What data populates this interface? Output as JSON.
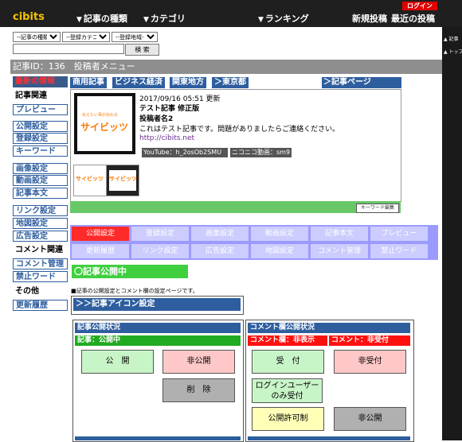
{
  "header": {
    "logo": "cibits",
    "login": "ログイン",
    "nav": {
      "article_type": "記事の種類",
      "category": "カテゴリ",
      "ranking": "ランキング",
      "new_post": "新規投稿",
      "recent_post": "最近の投稿"
    }
  },
  "right_strip": [
    "▲ 記事",
    "▲ トップ"
  ],
  "search": {
    "selects": [
      "--記事の種類--",
      "--登録カテゴリー--",
      "--登録地域--"
    ],
    "button": "検 索"
  },
  "title_bar": "記事ID：136　投稿者メニュー",
  "sidebar": [
    {
      "label": "最新の情報",
      "style": "red"
    },
    {
      "label": "記事関連",
      "style": "heading"
    },
    {
      "label": "プレビュー",
      "style": "box"
    },
    {
      "label": "公開設定",
      "style": "box"
    },
    {
      "label": "登録設定",
      "style": "box"
    },
    {
      "label": "キーワード",
      "style": "box"
    },
    {
      "label": "画像設定",
      "style": "box"
    },
    {
      "label": "動画設定",
      "style": "box"
    },
    {
      "label": "記事本文",
      "style": "box"
    },
    {
      "label": "リンク設定",
      "style": "box"
    },
    {
      "label": "地図設定",
      "style": "box"
    },
    {
      "label": "広告設定",
      "style": "box"
    },
    {
      "label": "コメント関連",
      "style": "heading"
    },
    {
      "label": "コメント管理",
      "style": "box"
    },
    {
      "label": "禁止ワード",
      "style": "box"
    },
    {
      "label": "その他",
      "style": "heading"
    },
    {
      "label": "更新履歴",
      "style": "box"
    }
  ],
  "tags": [
    "商用記事",
    "ビジネス経済",
    "関東地方",
    "＞東京都"
  ],
  "article_page_link": "＞記事ページ",
  "preview": {
    "logo_text": "サイビッツ",
    "logo_subtext": "伝えたい事が伝わる",
    "date_line": "2017/09/16 05:51 更新",
    "title": "テスト記事 修正版",
    "author": "投稿者名2",
    "body": "これはテスト記事です。問題がありましたらご連絡ください。",
    "url": "http://cibits.net",
    "youtube": "YouTube：h_2osOb2SMU",
    "niconico": "ニコニコ動画：sm9",
    "keyword_button": "キーワード編集"
  },
  "tab_grid": {
    "row1": [
      "公開設定",
      "登録設定",
      "画像設定",
      "動画設定",
      "記事本文",
      "プレビュー"
    ],
    "row2": [
      "更新履歴",
      "リンク設定",
      "広告設定",
      "地図設定",
      "コメント管理",
      "禁止ワード"
    ],
    "active": "公開設定"
  },
  "status_pill": "〇記事公開中",
  "note": "■記事の公開設定とコメント欄の設定ページです。",
  "icon_settings": "＞＞記事アイコン設定",
  "article_panel": {
    "title": "記事公開状況",
    "subheader": "記事：公開中",
    "buttons": {
      "public": "公　開",
      "private": "非公開",
      "delete": "削　除"
    }
  },
  "comment_panel": {
    "title": "コメント欄公開状況",
    "sub_left": "コメント欄：非表示",
    "sub_right": "コメント：非受付",
    "buttons": {
      "accept": "受　付",
      "reject": "非受付",
      "login_only_line1": "ログインユーザー",
      "login_only_line2": "のみ受付",
      "approval": "公開許可制",
      "private": "非公開"
    }
  },
  "colors": {
    "accent_blue": "#2e5e9e",
    "active_red": "#ff2a2a",
    "status_green": "#3fcf3f",
    "tab_bg": "#ccccff"
  }
}
